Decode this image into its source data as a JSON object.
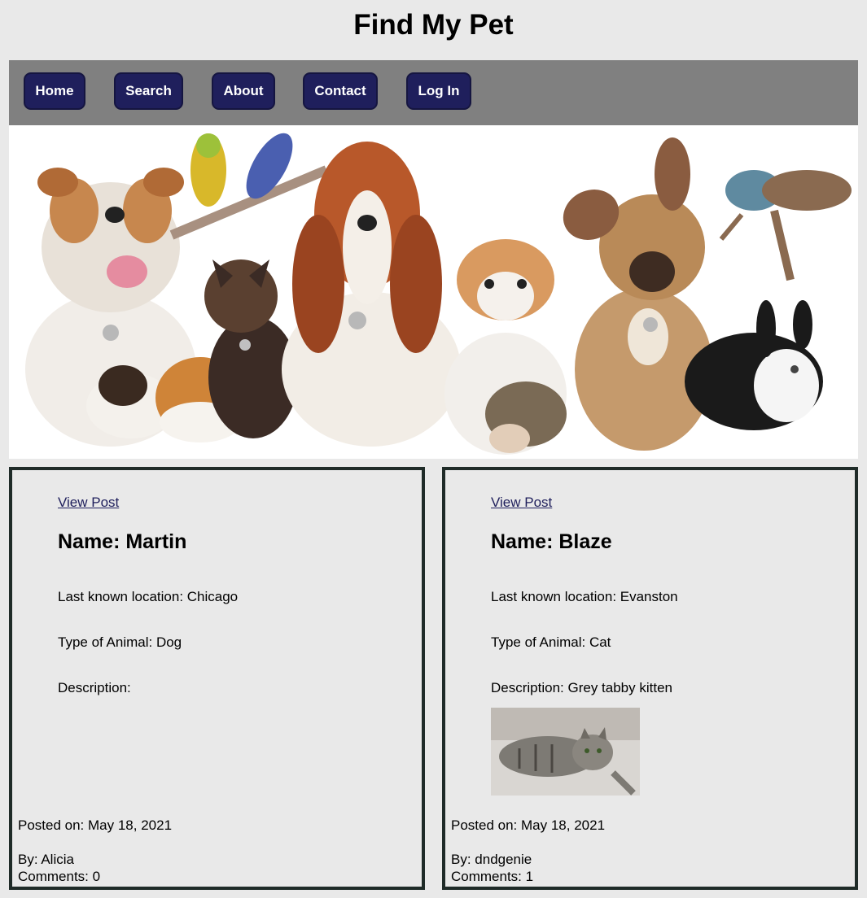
{
  "site": {
    "title": "Find My Pet"
  },
  "nav": {
    "items": [
      {
        "label": "Home"
      },
      {
        "label": "Search"
      },
      {
        "label": "About"
      },
      {
        "label": "Contact"
      },
      {
        "label": "Log In"
      }
    ]
  },
  "banner": {
    "icon": "pets-group-image"
  },
  "posts": [
    {
      "link": "View Post",
      "name": "Name: Martin",
      "location": "Last known location: Chicago",
      "type": "Type of Animal: Dog",
      "description": "Description:",
      "posted_on": "Posted on: May 18, 2021",
      "by": "By: Alicia",
      "comments": "Comments: 0"
    },
    {
      "link": "View Post",
      "name": "Name: Blaze",
      "location": "Last known location: Evanston",
      "type": "Type of Animal: Cat",
      "description": "Description: Grey tabby kitten",
      "posted_on": "Posted on: May 18, 2021",
      "by": "By: dndgenie",
      "comments": "Comments: 1",
      "photo_icon": "tabby-cat-photo"
    }
  ],
  "colors": {
    "background": "#e9e9e9",
    "navbar": "#808080",
    "nav_button": "#1f1f5c",
    "card_border": "#1f2b28",
    "link": "#1f1f5c"
  }
}
